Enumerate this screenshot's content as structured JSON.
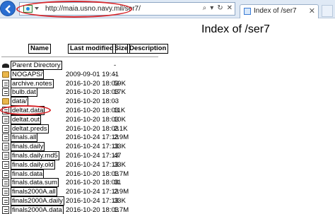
{
  "browser": {
    "url_host": "maia.usno.navy.mil",
    "url_prefix": "http://",
    "url_path": "/ser7/",
    "url_tools": [
      "⌕",
      "▾",
      "↻",
      "✕"
    ],
    "tab_title": "Index of /ser7",
    "tab_close": "✕"
  },
  "page": {
    "title": "Index of /ser7",
    "columns": [
      "Name",
      "Last modified",
      "Size",
      "Description"
    ],
    "rows": [
      {
        "icon": "back-icon",
        "name": "Parent Directory",
        "date": "",
        "size": "-"
      },
      {
        "icon": "folder-icon",
        "name": "NOGAPS/",
        "date": "2009-09-01 19:41",
        "size": "-"
      },
      {
        "icon": "file-icon",
        "name": "archive.notes",
        "date": "2016-10-20 18:03",
        "size": "59K"
      },
      {
        "icon": "file-icon",
        "name": "bulb.dat",
        "date": "2016-10-20 18:03",
        "size": "17K"
      },
      {
        "icon": "folder-icon",
        "name": "data/",
        "date": "2016-10-20 18:03",
        "size": "-"
      },
      {
        "icon": "file-icon",
        "name": "deltat.data",
        "date": "2016-10-20 18:03",
        "size": "11K"
      },
      {
        "icon": "file-icon",
        "name": "deltat.out",
        "date": "2016-10-20 18:03",
        "size": "10K"
      },
      {
        "icon": "file-icon",
        "name": "deltat.preds",
        "date": "2016-10-20 18:03",
        "size": "2.1K"
      },
      {
        "icon": "file-icon",
        "name": "finals.all",
        "date": "2016-10-24 17:13",
        "size": "2.9M"
      },
      {
        "icon": "file-icon",
        "name": "finals.daily",
        "date": "2016-10-24 17:13",
        "size": "33K"
      },
      {
        "icon": "file-icon",
        "name": "finals.daily.md5",
        "date": "2016-10-24 17:13",
        "size": "47"
      },
      {
        "icon": "file-icon",
        "name": "finals.daily.old",
        "date": "2016-10-24 17:13",
        "size": "33K"
      },
      {
        "icon": "file-icon",
        "name": "finals.data",
        "date": "2016-10-20 18:03",
        "size": "1.7M"
      },
      {
        "icon": "file-icon",
        "name": "finals.data.sum",
        "date": "2016-10-20 18:03",
        "size": "31"
      },
      {
        "icon": "file-icon",
        "name": "finals2000A.all",
        "date": "2016-10-24 17:13",
        "size": "2.9M"
      },
      {
        "icon": "file-icon",
        "name": "finals2000A.daily",
        "date": "2016-10-24 17:13",
        "size": "33K"
      },
      {
        "icon": "file-icon",
        "name": "finals2000A.data",
        "date": "2016-10-20 18:03",
        "size": "1.7M"
      }
    ]
  },
  "colors": {
    "highlight": "#d7262b",
    "folder": "#e9b64b"
  }
}
